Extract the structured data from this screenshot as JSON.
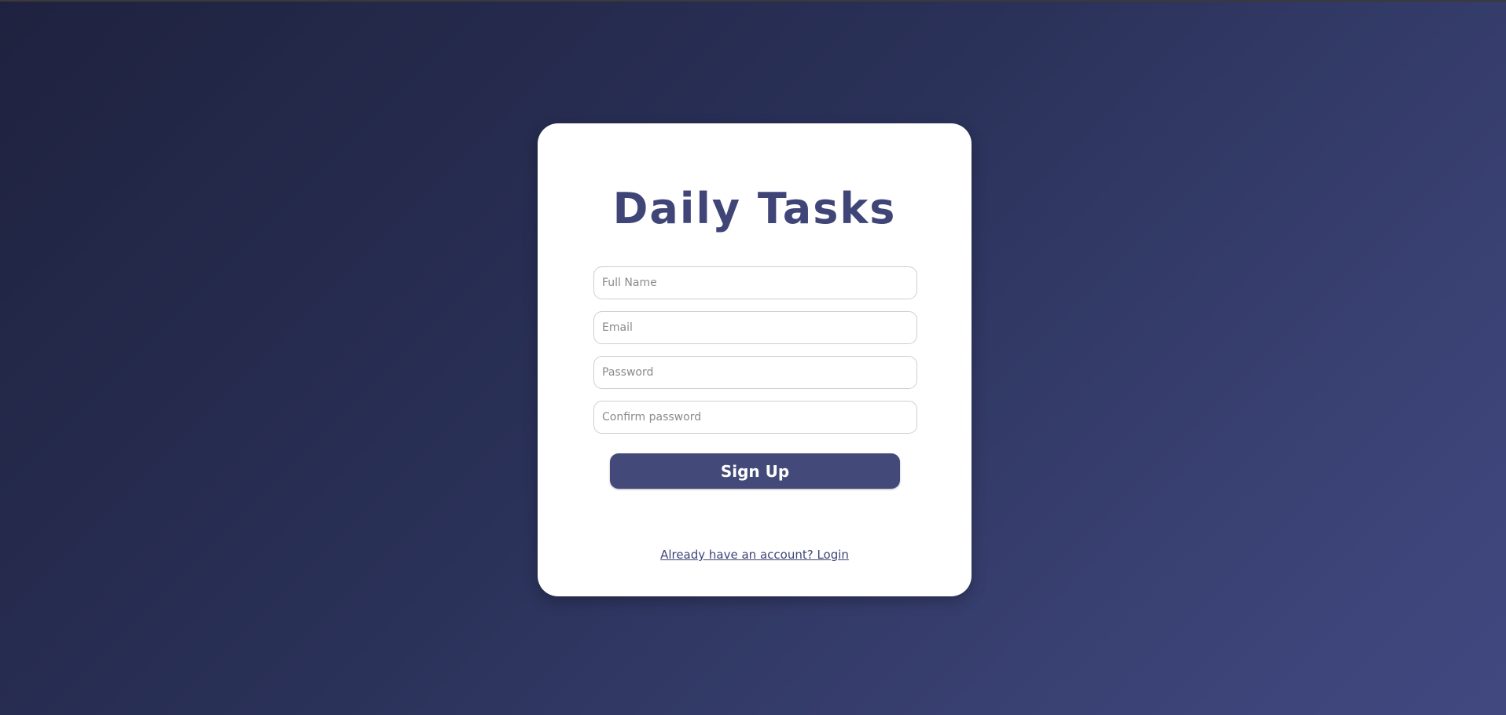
{
  "app": {
    "title": "Daily Tasks"
  },
  "form": {
    "full_name_placeholder": "Full Name",
    "email_placeholder": "Email",
    "password_placeholder": "Password",
    "confirm_password_placeholder": "Confirm password",
    "submit_label": "Sign Up"
  },
  "footer": {
    "login_link": "Already have an account? Login"
  },
  "colors": {
    "accent": "#434a7a",
    "title": "#3f4577",
    "background_start": "#1f223f",
    "background_end": "#414880"
  }
}
